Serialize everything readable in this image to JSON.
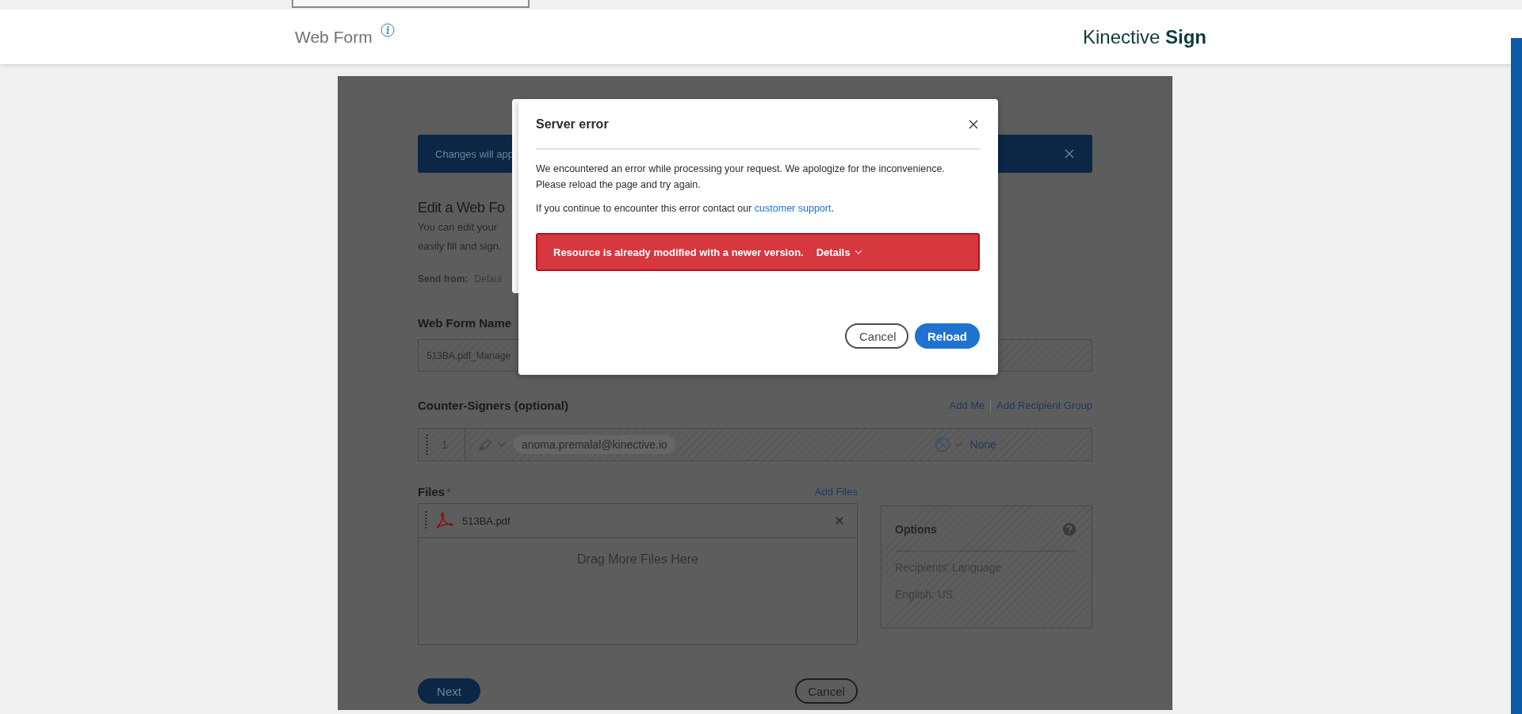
{
  "header": {
    "title": "Web Form",
    "brand": {
      "name": "Kinective",
      "emphasis": "Sign"
    }
  },
  "form": {
    "banner": {
      "text": "Changes will app"
    },
    "heading": "Edit a Web Fo",
    "intro": [
      "You can edit your",
      "easily fill and sign."
    ],
    "send_from": {
      "label": "Send from:",
      "value": "Defaul"
    },
    "name_field": {
      "label": "Web Form Name",
      "value": "513BA.pdf_Manage"
    },
    "counter_signers": {
      "label": "Counter-Signers (optional)",
      "links": [
        "Add Me",
        "Add Recipient Group"
      ],
      "recipients": [
        {
          "order": "1",
          "email": "anoma.premalal@kinective.io",
          "auth": "None"
        }
      ]
    },
    "files": {
      "label": "Files",
      "required_mark": "*",
      "add_link": "Add Files",
      "items": [
        {
          "name": "513BA.pdf"
        }
      ],
      "drop_hint": "Drag More Files Here"
    },
    "options": {
      "title": "Options",
      "items": [
        "Recipients' Language",
        "English: US"
      ]
    },
    "buttons": {
      "next": "Next",
      "cancel": "Cancel"
    }
  },
  "dialog": {
    "title": "Server error",
    "message": [
      "We encountered an error while processing your request. We apologize for the inconvenience.",
      "Please reload the page and try again."
    ],
    "contact": {
      "text": "If you continue to encounter this error contact our",
      "link": "customer support",
      "after": "."
    },
    "alert": {
      "text": "Resource is already modified with a newer version.",
      "details": "Details"
    },
    "buttons": [
      {
        "label": "Cancel",
        "kind": "secondary"
      },
      {
        "label": "Reload",
        "kind": "primary"
      }
    ]
  }
}
